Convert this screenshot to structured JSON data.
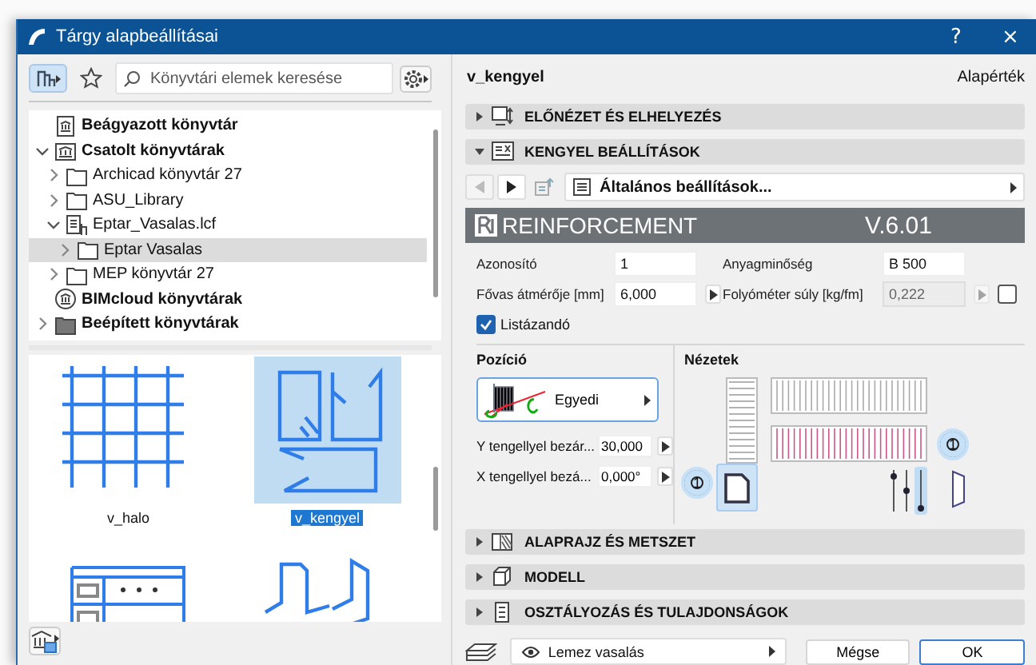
{
  "window": {
    "title": "Tárgy alapbeállításai",
    "buttons": [
      "?",
      "×"
    ]
  },
  "library": {
    "search": {
      "placeholder": "Könyvtári elemek keresése"
    },
    "tree": [
      {
        "kind": "embedded",
        "label": "Beágyazott könyvtár",
        "selected": false
      },
      {
        "kind": "linked",
        "label": "Csatolt könyvtárak",
        "expanded": true,
        "selected": false,
        "children": [
          {
            "kind": "folder",
            "label": "Archicad könyvtár 27",
            "expanded": false,
            "selected": false
          },
          {
            "kind": "folder",
            "label": "ASU_Library",
            "expanded": false,
            "selected": false
          },
          {
            "kind": "lcf",
            "label": "Eptar_Vasalas.lcf",
            "expanded": true,
            "selected": false,
            "children": [
              {
                "kind": "folder",
                "label": "Eptar Vasalas",
                "expanded": false,
                "selected": true
              }
            ]
          },
          {
            "kind": "folder",
            "label": "MEP könyvtár 27",
            "expanded": false,
            "selected": false
          }
        ]
      },
      {
        "kind": "cloud",
        "label": "BIMcloud könyvtárak",
        "selected": false
      },
      {
        "kind": "builtin",
        "label": "Beépített könyvtárak",
        "expanded": false,
        "selected": false
      }
    ],
    "items": [
      {
        "kind": "mesh",
        "label": "v_halo",
        "selected": false
      },
      {
        "kind": "stirrup",
        "label": "v_kengyel",
        "selected": true
      },
      {
        "kind": "table",
        "selected": false
      },
      {
        "kind": "zigzag",
        "selected": false
      }
    ]
  },
  "object": {
    "name": "v_kengyel",
    "preset": "Alapérték"
  },
  "sections": [
    {
      "kind": "preview",
      "label": "ELŐNÉZET ÉS ELHELYEZÉS",
      "expanded": false
    },
    {
      "kind": "settings",
      "label": "KENGYEL BEÁLLÍTÁSOK",
      "expanded": true
    },
    {
      "kind": "plan",
      "label": "ALAPRAJZ ÉS METSZET",
      "expanded": false
    },
    {
      "kind": "model",
      "label": "MODELL",
      "expanded": false
    },
    {
      "kind": "classification",
      "label": "OSZTÁLYOZÁS ÉS TULAJDONSÁGOK",
      "expanded": false
    }
  ],
  "settings": {
    "page": "Általános beállítások...",
    "banner": {
      "title": "REINFORCEMENT",
      "version": "V.6.01"
    },
    "fields": [
      {
        "label": "Azonosító",
        "value": "1",
        "disabled": false
      },
      {
        "label": "Anyagminőség",
        "value": "B 500",
        "disabled": false
      },
      {
        "label": "Fővas átmérője [mm]",
        "value": "6,000",
        "disabled": false,
        "stepper": true
      },
      {
        "label": "Folyóméter súly [kg/fm]",
        "value": "0,222",
        "disabled": true,
        "stepper": true,
        "checked": false
      }
    ],
    "listed": {
      "label": "Listázandó",
      "checked": true
    },
    "position": {
      "title": "Pozíció",
      "option": "Egyedi",
      "angles": [
        {
          "label": "Y tengellyel bezár...",
          "value": "30,000"
        },
        {
          "label": "X tengellyel bezá...",
          "value": "0,000°"
        }
      ]
    },
    "views": {
      "title": "Nézetek",
      "badges": [
        {
          "text": "1",
          "on": true
        },
        {
          "text": "1",
          "on": true
        }
      ]
    }
  },
  "footer": {
    "layer": "Lemez vasalás",
    "buttons": [
      {
        "label": "Mégse",
        "default": false
      },
      {
        "label": "OK",
        "default": true
      }
    ]
  }
}
